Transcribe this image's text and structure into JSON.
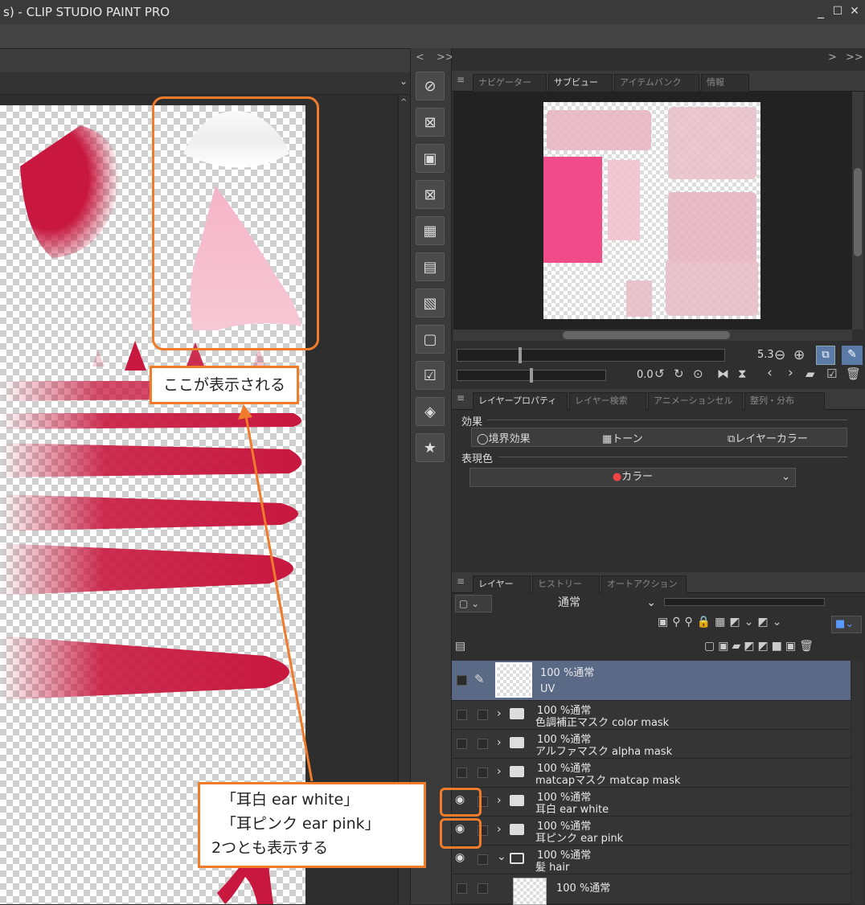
{
  "window": {
    "title": "s) - CLIP STUDIO PAINT PRO",
    "minimize": "_",
    "maximize": "☐",
    "close": "✕"
  },
  "panel_nav": {
    "collapse_left": "<",
    "collapse_right": ">>",
    "far_right": ">",
    "far_right2": ">>"
  },
  "subview_tabs": [
    {
      "label": "ナビゲーター"
    },
    {
      "label": "サブビュー"
    },
    {
      "label": "アイテムバンク"
    },
    {
      "label": "情報"
    }
  ],
  "subview_controls": {
    "zoom": "5.3",
    "rotation": "0.0"
  },
  "property_tabs": [
    {
      "label": "レイヤープロパティ"
    },
    {
      "label": "レイヤー検索"
    },
    {
      "label": "アニメーションセル"
    },
    {
      "label": "整列・分布"
    }
  ],
  "properties": {
    "effect_heading": "効果",
    "border_effect": "境界効果",
    "tone": "トーン",
    "layer_color": "レイヤーカラー",
    "expression_heading": "表現色",
    "color_select": "カラー"
  },
  "layer_tabs": [
    {
      "label": "レイヤー"
    },
    {
      "label": "ヒストリー"
    },
    {
      "label": "オートアクション"
    }
  ],
  "layer_blend": {
    "mode": "通常"
  },
  "layers": [
    {
      "pct": "100 %通常",
      "name": "UV",
      "selected": true,
      "visible": false,
      "type": "raster"
    },
    {
      "pct": "100 %通常",
      "name": "色調補正マスク color mask",
      "visible": false,
      "type": "folder"
    },
    {
      "pct": "100 %通常",
      "name": "アルファマスク alpha mask",
      "visible": false,
      "type": "folder"
    },
    {
      "pct": "100 %通常",
      "name": "matcapマスク matcap mask",
      "visible": false,
      "type": "folder"
    },
    {
      "pct": "100 %通常",
      "name": "耳白 ear white",
      "visible": true,
      "type": "folder"
    },
    {
      "pct": "100 %通常",
      "name": "耳ピンク ear pink",
      "visible": true,
      "type": "folder"
    },
    {
      "pct": "100 %通常",
      "name": "髪 hair",
      "visible": true,
      "type": "folder-open"
    },
    {
      "pct": "100 %通常",
      "name": "",
      "visible": false,
      "type": "raster-child"
    }
  ],
  "annotations": {
    "top_callout": "ここが表示される",
    "bottom_callout_line1": "「耳白 ear white」",
    "bottom_callout_line2": "「耳ピンク ear pink」",
    "bottom_callout_line3": "2つとも表示する"
  },
  "colors": {
    "annotation": "#f07b2a",
    "crimson": "#c8183f",
    "ear_pink": "#f2a6bf",
    "selected_layer": "#5a6a86"
  }
}
